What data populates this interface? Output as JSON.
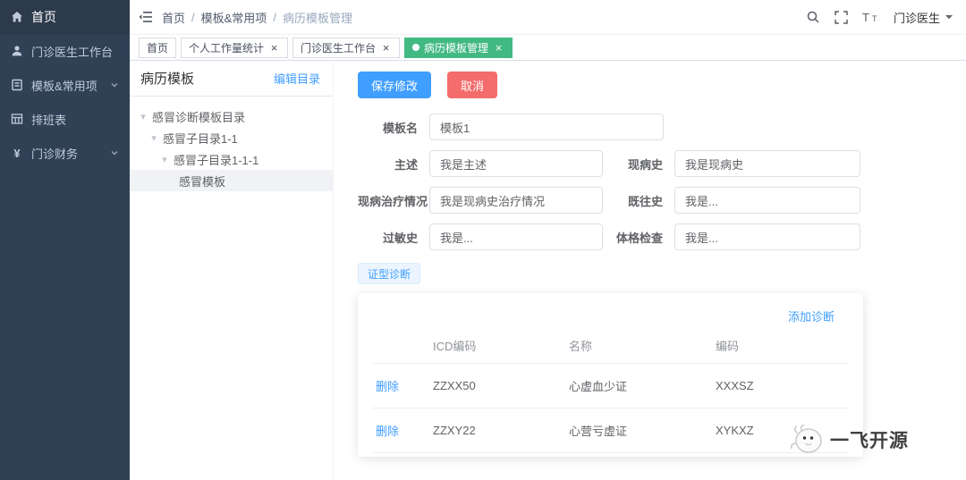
{
  "sidebar": {
    "items": [
      {
        "label": "首页"
      },
      {
        "label": "门诊医生工作台"
      },
      {
        "label": "模板&常用项",
        "has_submenu": true
      },
      {
        "label": "排班表"
      },
      {
        "label": "门诊财务",
        "has_submenu": true
      }
    ]
  },
  "topbar": {
    "breadcrumb": {
      "item1": "首页",
      "item2": "模板&常用项",
      "item3": "病历模板管理",
      "separator": "/"
    },
    "user_name": "门诊医生"
  },
  "tags": [
    {
      "label": "首页",
      "closable": false,
      "active": false
    },
    {
      "label": "个人工作量统计",
      "closable": true,
      "active": false
    },
    {
      "label": "门诊医生工作台",
      "closable": true,
      "active": false
    },
    {
      "label": "病历模板管理",
      "closable": true,
      "active": true
    }
  ],
  "panel": {
    "title": "病历模板",
    "edit_label": "编辑目录",
    "tree": [
      {
        "label": "感冒诊断模板目录",
        "level": 0,
        "expanded": true
      },
      {
        "label": "感冒子目录1-1",
        "level": 1,
        "expanded": true
      },
      {
        "label": "感冒子目录1-1-1",
        "level": 2,
        "expanded": true
      },
      {
        "label": "感冒模板",
        "level": 3,
        "selected": true
      }
    ]
  },
  "form": {
    "save_label": "保存修改",
    "cancel_label": "取消",
    "template_name": {
      "label": "模板名",
      "value": "模板1"
    },
    "chief_complaint": {
      "label": "主述",
      "value": "我是主述"
    },
    "present_illness": {
      "label": "现病史",
      "value": "我是现病史"
    },
    "treatment": {
      "label": "现病治疗情况",
      "value": "我是现病史治疗情况"
    },
    "past_history": {
      "label": "既往史",
      "value": "我是..."
    },
    "allergy": {
      "label": "过敏史",
      "value": "我是..."
    },
    "physical_exam": {
      "label": "体格检查",
      "value": "我是..."
    },
    "diagnosis_tab_label": "证型诊断",
    "add_diagnosis_label": "添加诊断",
    "table": {
      "headers": [
        "",
        "ICD编码",
        "名称",
        "编码"
      ],
      "delete_label": "删除",
      "rows": [
        {
          "icd": "ZZXX50",
          "name": "心虚血少证",
          "code": "XXXSZ"
        },
        {
          "icd": "ZZXY22",
          "name": "心营亏虚证",
          "code": "XYKXZ"
        }
      ]
    }
  },
  "watermark": {
    "text": "一飞开源"
  },
  "icons": {
    "close": "×",
    "yen": "¥",
    "tree_caret": "▾"
  },
  "colors": {
    "primary": "#409eff",
    "danger": "#f56c6c",
    "active_tag": "#42b983",
    "sidebar_bg": "#304156",
    "chip_bg": "#ecf5ff"
  }
}
